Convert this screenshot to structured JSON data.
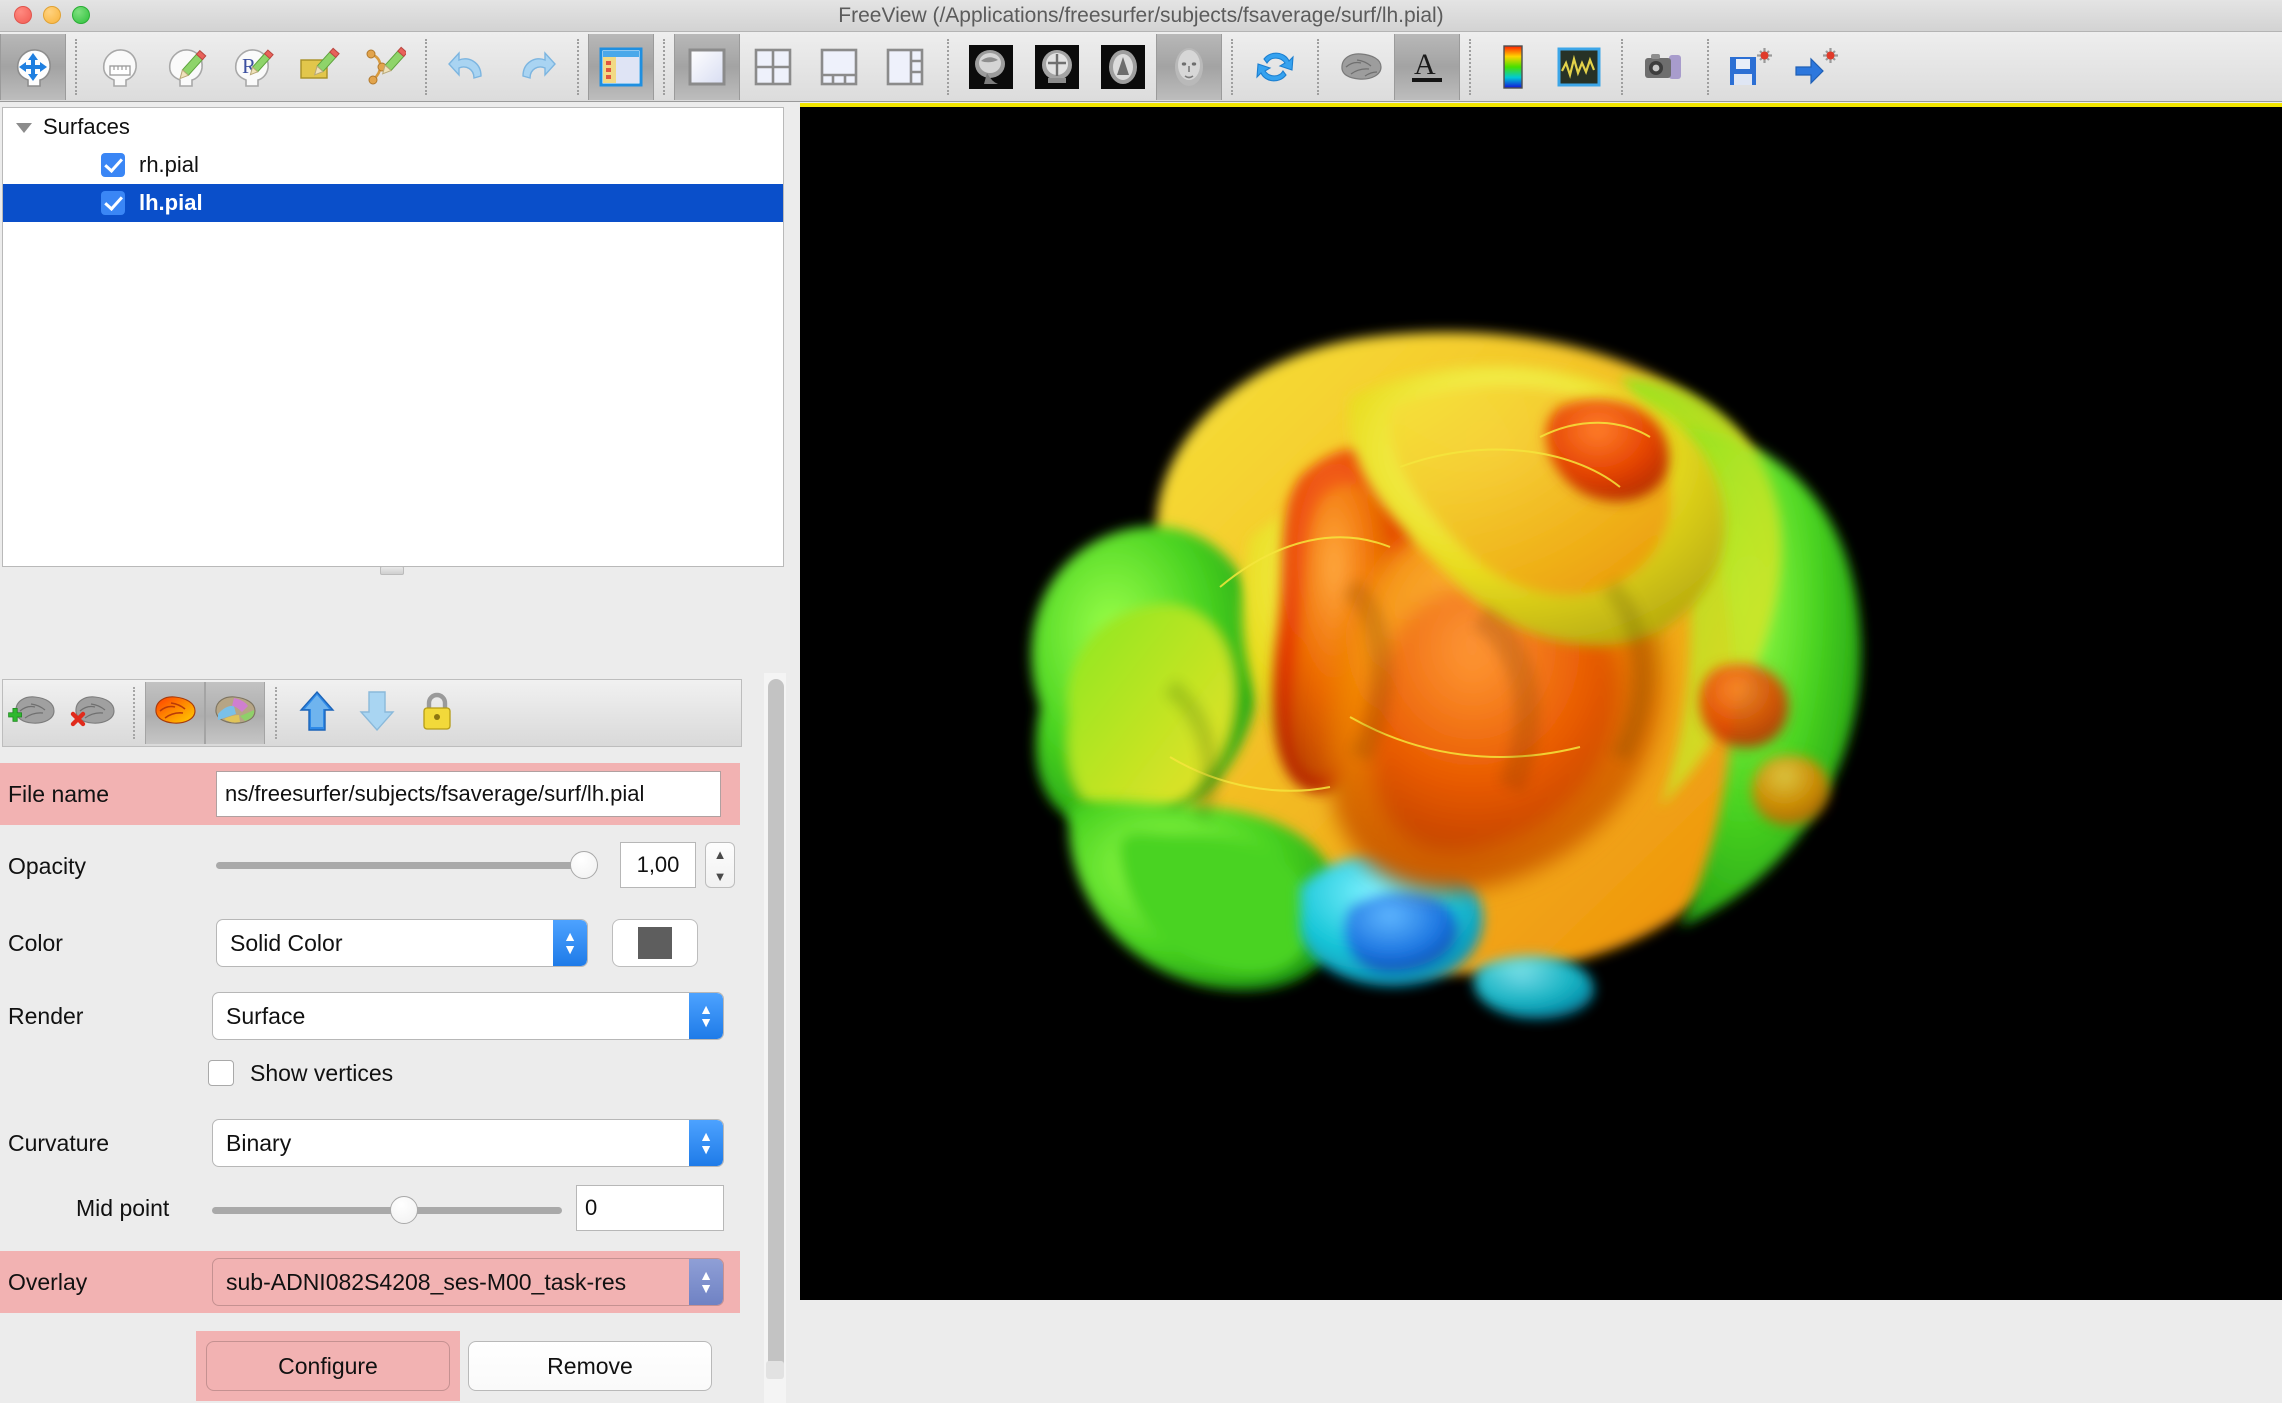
{
  "window": {
    "title": "FreeView (/Applications/freesurfer/subjects/fsaverage/surf/lh.pial)",
    "traffic_lights": [
      "close-button",
      "minimize-button",
      "zoom-button"
    ]
  },
  "toolbar": {
    "items": [
      {
        "name": "navigate-tool",
        "label": "Navigate",
        "active": true
      },
      {
        "name": "measure-tool",
        "label": "Measure",
        "active": false
      },
      {
        "name": "voxel-edit-tool",
        "label": "Voxel Edit",
        "active": false
      },
      {
        "name": "recon-edit-tool",
        "label": "Recon Edit",
        "active": false
      },
      {
        "name": "roi-edit-tool",
        "label": "ROI Edit",
        "active": false
      },
      {
        "name": "point-set-edit-tool",
        "label": "Point Set Edit",
        "active": false
      },
      {
        "name": "undo-button",
        "label": "Undo",
        "active": false
      },
      {
        "name": "redo-button",
        "label": "Redo",
        "active": false
      },
      {
        "name": "toggle-panel-button",
        "label": "Show/Hide Control Panel",
        "active": true
      },
      {
        "name": "layout-1x1-button",
        "label": "1x1 Layout",
        "active": true
      },
      {
        "name": "layout-2x2-button",
        "label": "2x2 Layout",
        "active": false
      },
      {
        "name": "layout-1x3-button",
        "label": "1x3 Layout",
        "active": false
      },
      {
        "name": "layout-1x3h-button",
        "label": "1x3 Horizontal Layout",
        "active": false
      },
      {
        "name": "view-sagittal-button",
        "label": "Sagittal",
        "active": false
      },
      {
        "name": "view-coronal-button",
        "label": "Coronal",
        "active": false
      },
      {
        "name": "view-axial-button",
        "label": "Axial",
        "active": false
      },
      {
        "name": "view-3d-button",
        "label": "3D",
        "active": true
      },
      {
        "name": "reset-view-button",
        "label": "Reset View",
        "active": false
      },
      {
        "name": "show-surfaces-button",
        "label": "Show Surfaces",
        "active": false
      },
      {
        "name": "show-labels-button",
        "label": "Show Annotation",
        "active": true
      },
      {
        "name": "show-colorscale-button",
        "label": "Show Color Scale",
        "active": false
      },
      {
        "name": "time-course-button",
        "label": "Show Time Course",
        "active": false
      },
      {
        "name": "screenshot-button",
        "label": "Save Screenshot",
        "active": false
      },
      {
        "name": "save-point-set-button",
        "label": "Save Point Set",
        "active": false
      },
      {
        "name": "goto-point-set-button",
        "label": "Go To Point Set",
        "active": false
      }
    ]
  },
  "layer_tree": {
    "group_label": "Surfaces",
    "expanded": true,
    "layers": [
      {
        "label": "rh.pial",
        "checked": true,
        "selected": false
      },
      {
        "label": "lh.pial",
        "checked": true,
        "selected": true
      }
    ]
  },
  "layer_toolbar": {
    "items": [
      {
        "name": "load-surface-button",
        "label": "Load Surface",
        "pressed": false
      },
      {
        "name": "unload-surface-button",
        "label": "Unload Surface",
        "pressed": false
      },
      {
        "name": "show-overlay-button",
        "label": "Show Overlay",
        "pressed": true
      },
      {
        "name": "show-annotation-button",
        "label": "Show Annotation",
        "pressed": true
      },
      {
        "name": "move-layer-up-button",
        "label": "Move Layer Up",
        "pressed": false
      },
      {
        "name": "move-layer-down-button",
        "label": "Move Layer Down",
        "pressed": false
      },
      {
        "name": "lock-layer-button",
        "label": "Lock Layer",
        "pressed": false
      }
    ]
  },
  "properties": {
    "file_name": {
      "label": "File name",
      "value": "ns/freesurfer/subjects/fsaverage/surf/lh.pial"
    },
    "opacity": {
      "label": "Opacity",
      "value": "1,00",
      "slider_percent": 100
    },
    "color": {
      "label": "Color",
      "value": "Solid Color",
      "swatch_hex": "#5e5e5e"
    },
    "render": {
      "label": "Render",
      "value": "Surface"
    },
    "show_vertices": {
      "label": "Show vertices",
      "checked": false
    },
    "curvature": {
      "label": "Curvature",
      "value": "Binary"
    },
    "mid_point": {
      "label": "Mid point",
      "value": "0",
      "slider_percent": 52
    },
    "overlay": {
      "label": "Overlay",
      "value": "sub-ADNI082S4208_ses-M00_task-res"
    },
    "overlay_buttons": {
      "configure": "Configure",
      "remove": "Remove"
    }
  },
  "render_view": {
    "name": "3d-render-view",
    "background_hex": "#000000",
    "focus_border_hex": "#f2e500",
    "content": "3D pial surface with functional heat-map overlay"
  }
}
